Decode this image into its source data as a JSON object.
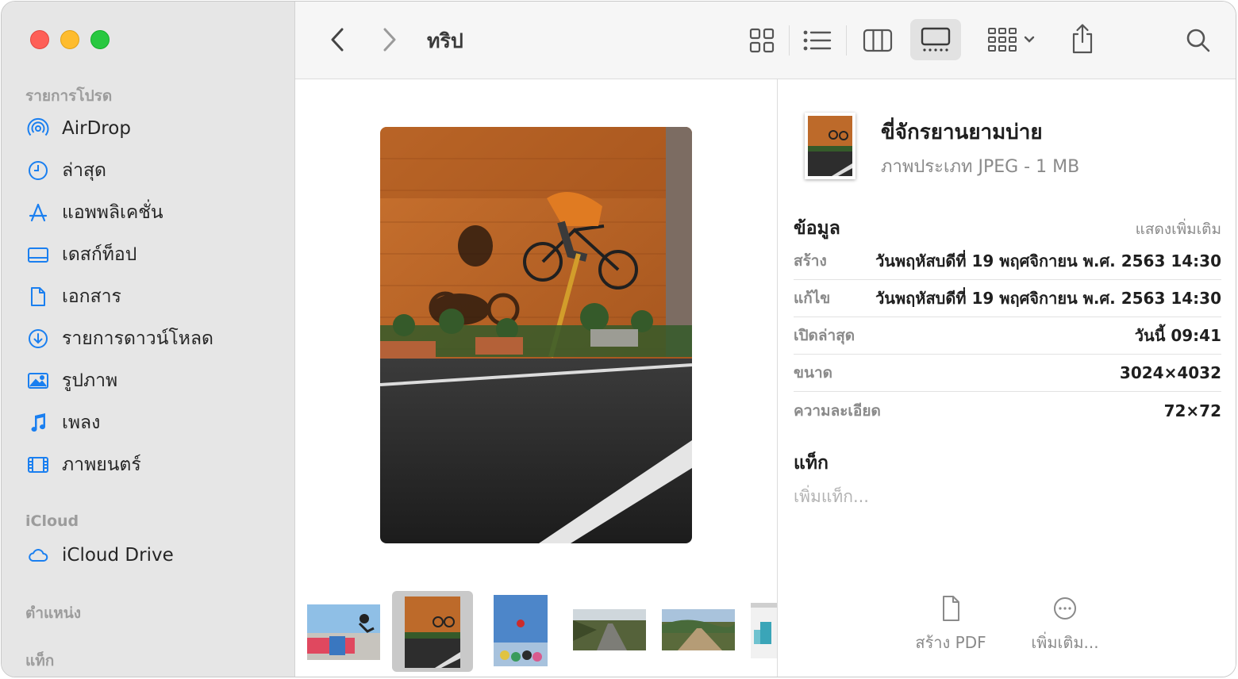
{
  "toolbar": {
    "folder_title": "ทริป",
    "icons": {
      "back": "chevron-left-icon",
      "forward": "chevron-right-icon",
      "icon_view": "grid-icon",
      "list_view": "list-icon",
      "column_view": "columns-icon",
      "gallery_view": "gallery-icon",
      "group": "group-icon",
      "share": "share-icon",
      "search": "search-icon"
    }
  },
  "sidebar": {
    "favorites_title": "รายการโปรด",
    "favorites": [
      {
        "label": "AirDrop",
        "icon": "airdrop-icon"
      },
      {
        "label": "ล่าสุด",
        "icon": "clock-icon"
      },
      {
        "label": "แอพพลิเคชั่น",
        "icon": "applications-icon"
      },
      {
        "label": "เดสก์ท็อป",
        "icon": "desktop-icon"
      },
      {
        "label": "เอกสาร",
        "icon": "document-icon"
      },
      {
        "label": "รายการดาวน์โหลด",
        "icon": "download-icon"
      },
      {
        "label": "รูปภาพ",
        "icon": "photo-icon"
      },
      {
        "label": "เพลง",
        "icon": "music-icon"
      },
      {
        "label": "ภาพยนตร์",
        "icon": "film-icon"
      }
    ],
    "icloud_title": "iCloud",
    "icloud": [
      {
        "label": "iCloud Drive",
        "icon": "cloud-icon"
      }
    ],
    "locations_title": "ตำแหน่ง",
    "tags_title": "แท็ก"
  },
  "inspector": {
    "file_name": "ขี่จักรยานยามบ่าย",
    "file_subtitle": "ภาพประเภท JPEG - 1 MB",
    "info_title": "ข้อมูล",
    "show_more": "แสดงเพิ่มเติม",
    "rows": [
      {
        "key": "สร้าง",
        "value": "วันพฤหัสบดีที่ 19 พฤศจิกายน พ.ศ. 2563 14:30"
      },
      {
        "key": "แก้ไข",
        "value": "วันพฤหัสบดีที่ 19 พฤศจิกายน พ.ศ. 2563 14:30"
      },
      {
        "key": "เปิดล่าสุด",
        "value": "วันนี้ 09:41"
      },
      {
        "key": "ขนาด",
        "value": "3024×4032"
      },
      {
        "key": "ความละเอียด",
        "value": "72×72"
      }
    ],
    "tags_title": "แท็ก",
    "tags_placeholder": "เพิ่มแท็ก...",
    "actions": [
      {
        "label": "สร้าง PDF",
        "icon": "document-icon"
      },
      {
        "label": "เพิ่มเติม...",
        "icon": "more-icon"
      }
    ]
  },
  "colors": {
    "accent": "#1a7ff0",
    "sidebar_bg": "#e6e6e6",
    "toolbar_bg": "#f6f6f6"
  }
}
